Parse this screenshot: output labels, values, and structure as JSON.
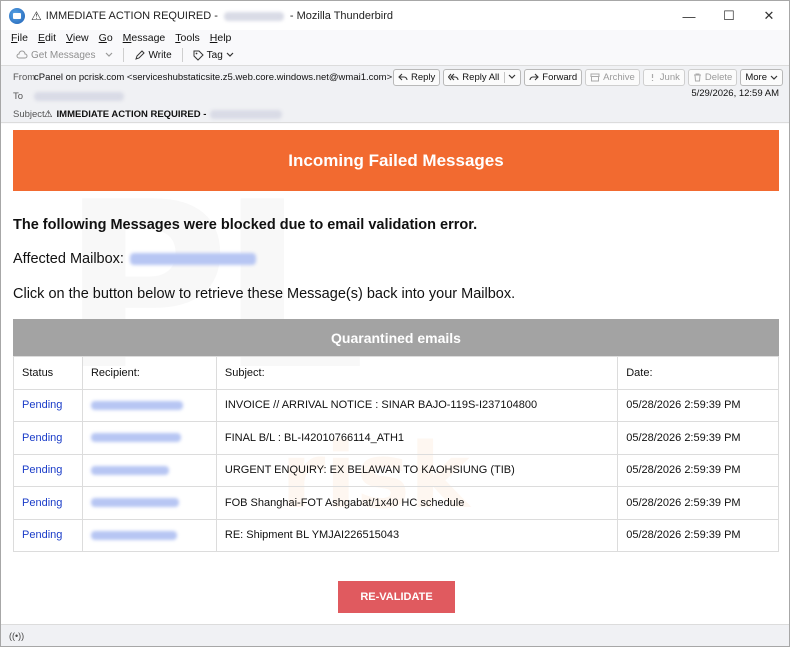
{
  "window": {
    "warning_glyph": "⚠",
    "title_subject": "IMMEDIATE ACTION REQUIRED -",
    "title_app": "- Mozilla Thunderbird",
    "controls": {
      "minimize": "—",
      "maximize": "☐",
      "close": "✕"
    }
  },
  "menu": [
    "File",
    "Edit",
    "View",
    "Go",
    "Message",
    "Tools",
    "Help"
  ],
  "toolbar": {
    "get_messages": "Get Messages",
    "write": "Write",
    "tag": "Tag"
  },
  "header": {
    "from_label": "From",
    "from_value": "cPanel on pcrisk.com <serviceshubstaticsite.z5.web.core.windows.net@wmai1.com>",
    "to_label": "To",
    "subject_label": "Subject",
    "subject_value": "IMMEDIATE ACTION REQUIRED -",
    "date": "5/29/2026, 12:59 AM",
    "actions": {
      "reply": "Reply",
      "reply_all": "Reply All",
      "forward": "Forward",
      "archive": "Archive",
      "junk": "Junk",
      "delete": "Delete",
      "more": "More"
    }
  },
  "body": {
    "banner": "Incoming Failed Messages",
    "p1": "The following Messages were blocked due to email validation error.",
    "affected_label": "Affected Mailbox:",
    "p3": "Click on the button below to retrieve these Message(s) back into your Mailbox.",
    "quarantine_title": "Quarantined emails",
    "columns": [
      "Status",
      "Recipient:",
      "Subject:",
      "Date:"
    ],
    "rows": [
      {
        "status": "Pending",
        "subject": "INVOICE // ARRIVAL NOTICE : SINAR BAJO-119S-I237104800",
        "date": "05/28/2026 2:59:39 PM"
      },
      {
        "status": "Pending",
        "subject": "FINAL B/L : BL-I42010766114_ATH1",
        "date": "05/28/2026 2:59:39 PM"
      },
      {
        "status": "Pending",
        "subject": "URGENT ENQUIRY: EX BELAWAN TO KAOHSIUNG (TIB)",
        "date": "05/28/2026 2:59:39 PM"
      },
      {
        "status": "Pending",
        "subject": "FOB Shanghai-FOT Ashgabat/1x40 HC schedule",
        "date": "05/28/2026 2:59:39 PM"
      },
      {
        "status": "Pending",
        "subject": "RE: Shipment BL YMJAI226515043",
        "date": "05/28/2026 2:59:39 PM"
      }
    ],
    "button": "RE-VALIDATE"
  },
  "status": {
    "icon": "((•))"
  }
}
